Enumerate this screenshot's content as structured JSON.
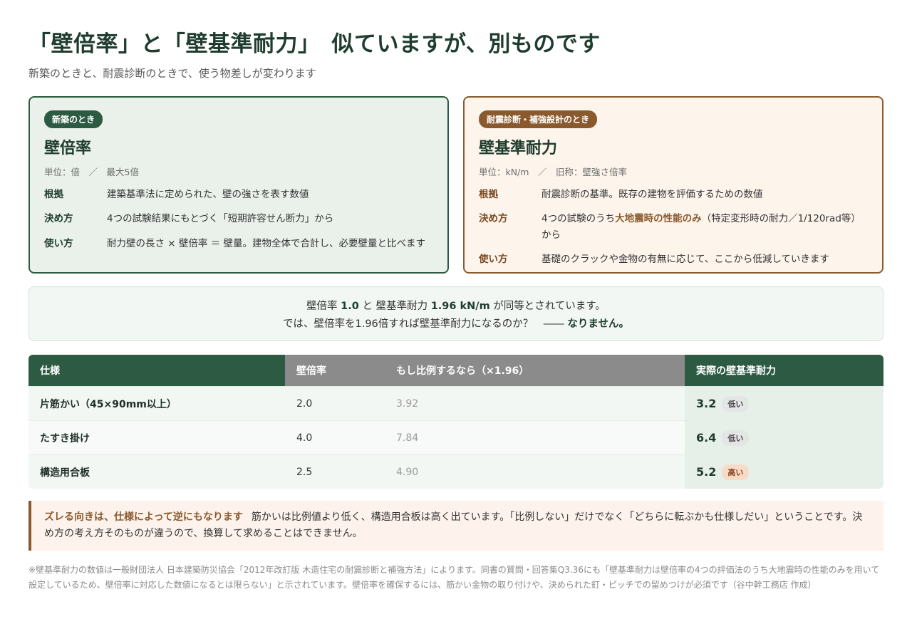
{
  "header": {
    "title": "「壁倍率」と「壁基準耐力」　似ていますが、別ものです",
    "subtitle": "新築のときと、耐震診断のときで、使う物差しが変わります"
  },
  "left_card": {
    "pill": "新築のとき",
    "title": "壁倍率",
    "unit": "単位：倍　／　最大5倍",
    "rows": [
      {
        "k": "根拠",
        "v": "建築基準法に定められた、壁の強さを表す数値"
      },
      {
        "k": "決め方",
        "v": "4つの試験結果にもとづく「短期許容せん断力」から"
      },
      {
        "k": "使い方",
        "v": "耐力壁の長さ × 壁倍率 ＝ 壁量。建物全体で合計し、必要壁量と比べます"
      }
    ]
  },
  "right_card": {
    "pill": "耐震診断・補強設計のとき",
    "title": "壁基準耐力",
    "unit": "単位：kN/m　／　旧称：壁強さ倍率",
    "rows": [
      {
        "k": "根拠",
        "v": "耐震診断の基準。既存の建物を評価するための数値"
      },
      {
        "k": "決め方",
        "v_pre": "4つの試験のうち",
        "v_em": "大地震時の性能のみ",
        "v_post": "（特定変形時の耐力／1/120rad等）から"
      },
      {
        "k": "使い方",
        "v": "基礎のクラックや金物の有無に応じて、ここから低減していきます"
      }
    ]
  },
  "callout": {
    "l1_a": "壁倍率 ",
    "l1_b": "1.0",
    "l1_c": " と 壁基準耐力 ",
    "l1_d": "1.96 kN/m",
    "l1_e": " が同等とされています。",
    "l2_a": "では、壁倍率を1.96倍すれば壁基準耐力になるのか？　―― ",
    "l2_b": "なりません。"
  },
  "table": {
    "headers": [
      "仕様",
      "壁倍率",
      "もし比例するなら（×1.96）",
      "実際の壁基準耐力"
    ],
    "rows": [
      {
        "spec": "片筋かい（45×90mm以上）",
        "ratio": "2.0",
        "prop": "3.92",
        "actual": "3.2",
        "badge": "低い",
        "kind": "low"
      },
      {
        "spec": "たすき掛け",
        "ratio": "4.0",
        "prop": "7.84",
        "actual": "6.4",
        "badge": "低い",
        "kind": "low"
      },
      {
        "spec": "構造用合板",
        "ratio": "2.5",
        "prop": "4.90",
        "actual": "5.2",
        "badge": "高い",
        "kind": "high"
      }
    ]
  },
  "note": {
    "lead": "ズレる向きは、仕様によって逆にもなります",
    "body": "筋かいは比例値より低く、構造用合板は高く出ています。「比例しない」だけでなく「どちらに転ぶかも仕様しだい」ということです。決め方の考え方そのものが違うので、換算して求めることはできません。"
  },
  "footnote": "※壁基準耐力の数値は一般財団法人 日本建築防災協会「2012年改訂版 木造住宅の耐震診断と補強方法」によります。同書の質問・回答集Q3.36にも「壁基準耐力は壁倍率の4つの評価法のうち大地震時の性能のみを用いて設定しているため、壁倍率に対応した数値になるとは限らない」と示されています。壁倍率を確保するには、筋かい金物の取り付けや、決められた釘・ピッチでの留めつけが必須です（谷中幹工務店 作成）"
}
